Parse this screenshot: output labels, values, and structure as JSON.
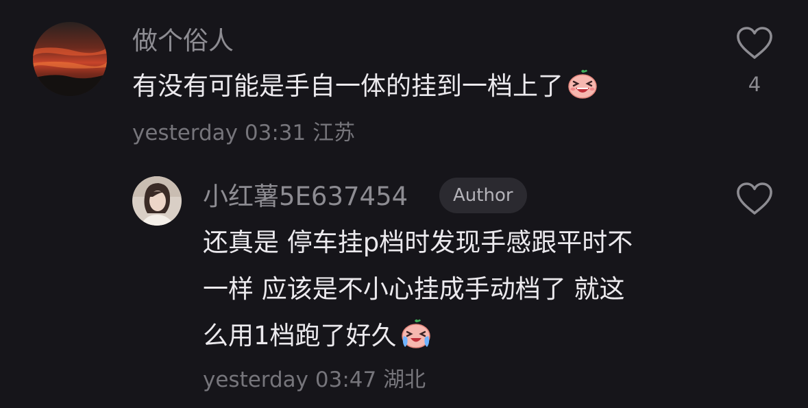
{
  "comments": [
    {
      "username": "做个俗人",
      "text": "有没有可能是手自一体的挂到一档上了",
      "emoji_name": "laughing-sticker",
      "time": "yesterday 03:31",
      "location": "江苏",
      "likes": "4"
    }
  ],
  "reply": {
    "username": "小红薯5E637454",
    "badge": "Author",
    "lines": [
      "还真是 停车挂p档时发现手感跟平时不",
      "一样 应该是不小心挂成手动档了 就这",
      "么用1档跑了好久"
    ],
    "emoji_name": "crying-laughing-sticker",
    "time": "yesterday 03:47",
    "location": "湖北",
    "likes": ""
  },
  "colors": {
    "background": "#16151a",
    "text_primary": "#eceaee",
    "text_secondary": "#8d8c92",
    "badge_bg": "#2b2a30"
  }
}
